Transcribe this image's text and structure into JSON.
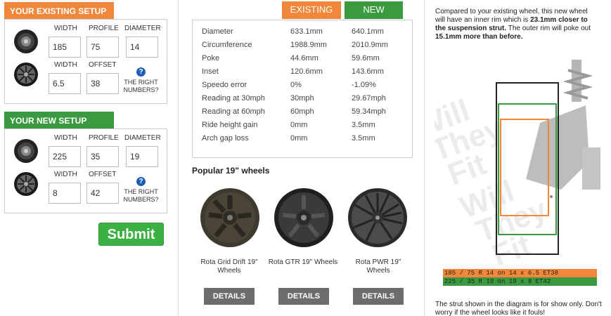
{
  "existing": {
    "title": "YOUR EXISTING SETUP",
    "labels": {
      "width": "WIDTH",
      "profile": "PROFILE",
      "diameter": "DIAMETER",
      "rim_width": "WIDTH",
      "offset": "OFFSET",
      "help": "THE RIGHT NUMBERS?"
    },
    "values": {
      "width": "185",
      "profile": "75",
      "diameter": "14",
      "rim_width": "6.5",
      "offset": "38"
    }
  },
  "new_setup": {
    "title": "YOUR NEW SETUP",
    "labels": {
      "width": "WIDTH",
      "profile": "PROFILE",
      "diameter": "DIAMETER",
      "rim_width": "WIDTH",
      "offset": "OFFSET",
      "help": "THE RIGHT NUMBERS?"
    },
    "values": {
      "width": "225",
      "profile": "35",
      "diameter": "19",
      "rim_width": "8",
      "offset": "42"
    }
  },
  "submit_label": "Submit",
  "tabs": {
    "existing": "EXISTING",
    "new": "NEW"
  },
  "comparison": [
    {
      "label": "Diameter",
      "existing": "633.1mm",
      "new": "640.1mm"
    },
    {
      "label": "Circumference",
      "existing": "1988.9mm",
      "new": "2010.9mm"
    },
    {
      "label": "Poke",
      "existing": "44.6mm",
      "new": "59.6mm"
    },
    {
      "label": "Inset",
      "existing": "120.6mm",
      "new": "143.6mm"
    },
    {
      "label": "Speedo error",
      "existing": "0%",
      "new": "-1.09%"
    },
    {
      "label": "Reading at 30mph",
      "existing": "30mph",
      "new": "29.67mph"
    },
    {
      "label": "Reading at 60mph",
      "existing": "60mph",
      "new": "59.34mph"
    },
    {
      "label": "Ride height gain",
      "existing": "0mm",
      "new": "3.5mm"
    },
    {
      "label": "Arch gap loss",
      "existing": "0mm",
      "new": "3.5mm"
    }
  ],
  "popular": {
    "title": "Popular 19\" wheels",
    "wheels": [
      {
        "name": "Rota Grid Drift 19\" Wheels",
        "details": "DETAILS"
      },
      {
        "name": "Rota GTR 19\" Wheels",
        "details": "DETAILS"
      },
      {
        "name": "Rota PWR 19\" Wheels",
        "details": "DETAILS"
      }
    ]
  },
  "summary": {
    "part1": "Compared to your existing wheel, this new wheel will have an inner rim which is ",
    "bold1": "23.1mm closer to the suspension strut.",
    "part2": " The outer rim will poke out ",
    "bold2": "15.1mm more than before."
  },
  "watermark": "Will They Fit .com",
  "legend": {
    "existing": "185 / 75 R 14 on 14 x 6.5 ET38",
    "new": "225 / 35 R 19 on 19 x 8 ET42"
  },
  "note": "The strut shown in the diagram is for show only. Don't worry if the wheel looks like it fouls!",
  "colors": {
    "existing": "#f0873a",
    "new": "#3a9a3f",
    "submit": "#3cb043",
    "details": "#6d6d6d"
  }
}
